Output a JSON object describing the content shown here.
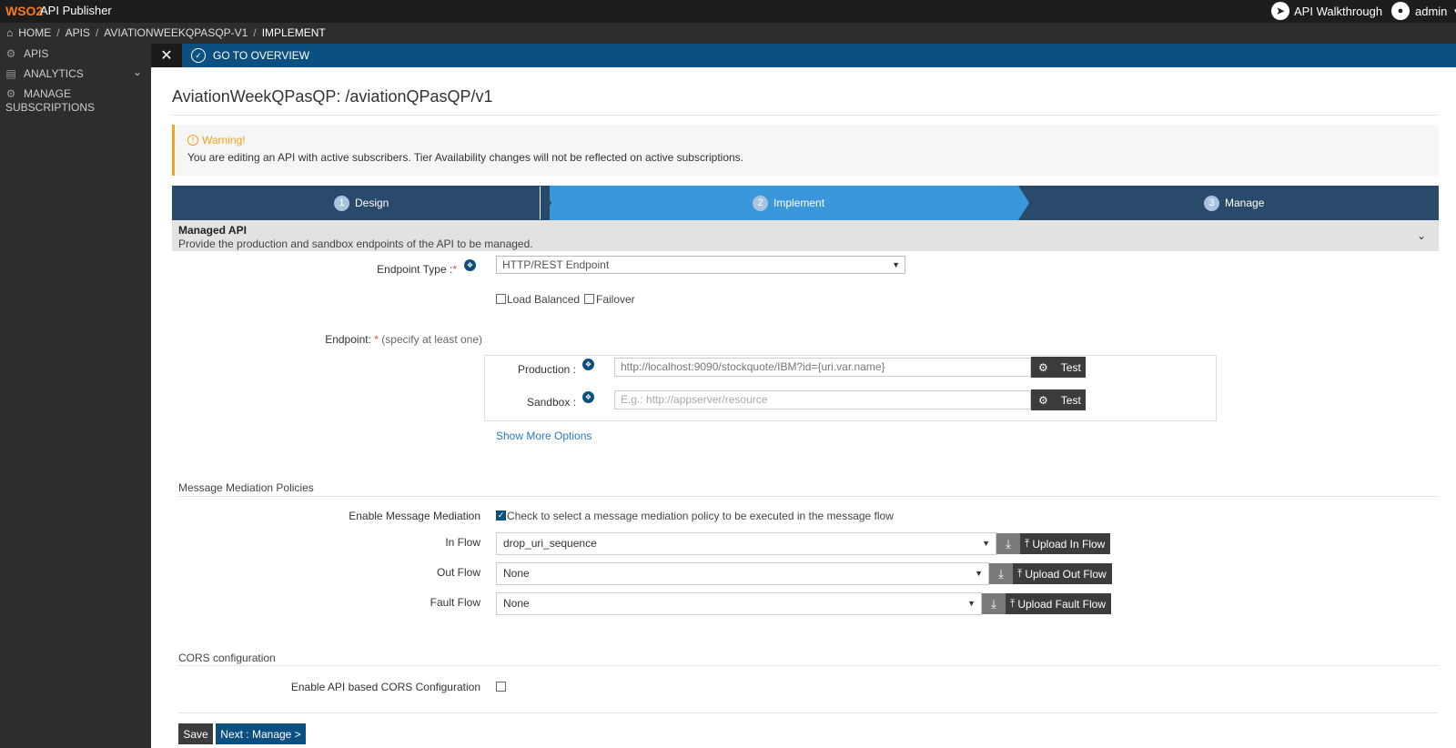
{
  "header": {
    "logo": "WSO2",
    "app_name": "API Publisher",
    "walkthrough": "API Walkthrough",
    "user": "admin"
  },
  "breadcrumb": {
    "home": "HOME",
    "apis": "APIS",
    "api": "AVIATIONWEEKQPASQP-V1",
    "current": "IMPLEMENT",
    "sep": "/"
  },
  "sidebar": {
    "items": [
      {
        "label": "APIS",
        "icon": "gear-icon"
      },
      {
        "label": "ANALYTICS",
        "icon": "chart-icon"
      },
      {
        "label": "MANAGE SUBSCRIPTIONS",
        "icon": "gear-icon"
      }
    ]
  },
  "overview": {
    "label": "GO TO OVERVIEW"
  },
  "page": {
    "title": "AviationWeekQPasQP: /aviationQPasQP/v1"
  },
  "warning": {
    "title": "Warning!",
    "message": "You are editing an API with active subscribers. Tier Availability changes will not be reflected on active subscriptions."
  },
  "steps": [
    {
      "num": "1",
      "label": "Design"
    },
    {
      "num": "2",
      "label": "Implement"
    },
    {
      "num": "3",
      "label": "Manage"
    }
  ],
  "managed": {
    "title": "Managed API",
    "subtitle": "Provide the production and sandbox endpoints of the API to be managed."
  },
  "endpoint_type": {
    "label": "Endpoint Type :",
    "value": "HTTP/REST Endpoint",
    "load_balanced": "Load Balanced",
    "failover": "Failover"
  },
  "endpoint": {
    "label": "Endpoint:",
    "hint": "(specify at least one)",
    "production_label": "Production :",
    "production_value": "http://localhost:9090/stockquote/IBM?id={uri.var.name}",
    "sandbox_label": "Sandbox :",
    "sandbox_placeholder": "E.g.: http://appserver/resource",
    "test": "Test",
    "more": "Show More Options"
  },
  "mediation": {
    "title": "Message Mediation Policies",
    "enable_label": "Enable Message Mediation",
    "enable_text": "Check to select a message mediation policy to be executed in the message flow",
    "in_label": "In Flow",
    "in_value": "drop_uri_sequence",
    "in_upload": "Upload In Flow",
    "out_label": "Out Flow",
    "out_value": "None",
    "out_upload": "Upload Out Flow",
    "fault_label": "Fault Flow",
    "fault_value": "None",
    "fault_upload": "Upload Fault Flow"
  },
  "cors": {
    "title": "CORS configuration",
    "enable_label": "Enable API based CORS Configuration"
  },
  "actions": {
    "save": "Save",
    "next": "Next : Manage >"
  }
}
